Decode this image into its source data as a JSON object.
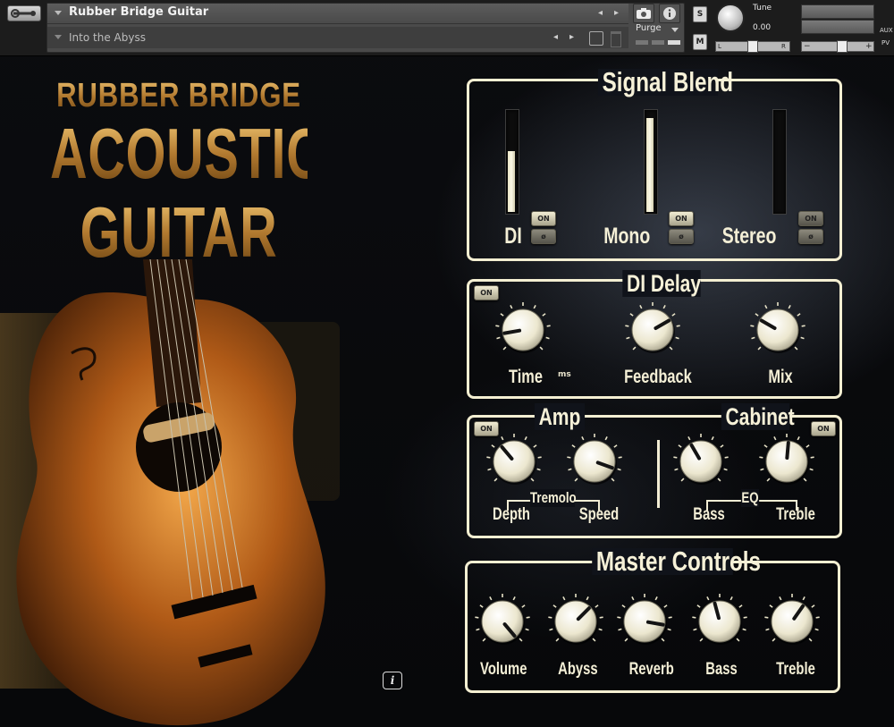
{
  "header": {
    "instrument_name": "Rubber Bridge Guitar",
    "preset_name": "Into the Abyss",
    "purge_label": "Purge",
    "solo_label": "S",
    "mute_label": "M",
    "tune_label": "Tune",
    "tune_value": "0.00",
    "pan_left": "L",
    "pan_right": "R",
    "vol_minus": "−",
    "vol_plus": "+",
    "aux_label": "AUX",
    "pv_label": "PV",
    "camera_icon": "camera-icon",
    "info_icon": "info-icon"
  },
  "logo": {
    "line1": "RUBBER BRIDGE",
    "line2": "ACOUSTIC",
    "line3": "GUITAR"
  },
  "info_button": "i",
  "signal_blend": {
    "title": "Signal Blend",
    "channels": [
      {
        "label": "DI",
        "level": 0.62,
        "on_label": "ON",
        "phase_label": "ø"
      },
      {
        "label": "Mono",
        "level": 0.95,
        "on_label": "ON",
        "phase_label": "ø"
      },
      {
        "label": "Stereo",
        "level": 0.0,
        "on_label": "ON",
        "phase_label": "ø"
      }
    ]
  },
  "di_delay": {
    "title": "DI Delay",
    "on_label": "ON",
    "unit": "ms",
    "knobs": [
      {
        "label": "Time",
        "angle": -100
      },
      {
        "label": "Feedback",
        "angle": 60
      },
      {
        "label": "Mix",
        "angle": -60
      }
    ]
  },
  "amp": {
    "title": "Amp",
    "on_label": "ON",
    "group_label": "Tremolo",
    "knobs": [
      {
        "label": "Depth",
        "angle": -40
      },
      {
        "label": "Speed",
        "angle": 110
      }
    ]
  },
  "cabinet": {
    "title": "Cabinet",
    "on_label": "ON",
    "group_label": "EQ",
    "knobs": [
      {
        "label": "Bass",
        "angle": -30
      },
      {
        "label": "Treble",
        "angle": 5
      }
    ]
  },
  "master": {
    "title": "Master Controls",
    "knobs": [
      {
        "label": "Volume",
        "angle": 140
      },
      {
        "label": "Abyss",
        "angle": 45
      },
      {
        "label": "Reverb",
        "angle": 100
      },
      {
        "label": "Bass",
        "angle": -15
      },
      {
        "label": "Treble",
        "angle": 35
      }
    ]
  }
}
